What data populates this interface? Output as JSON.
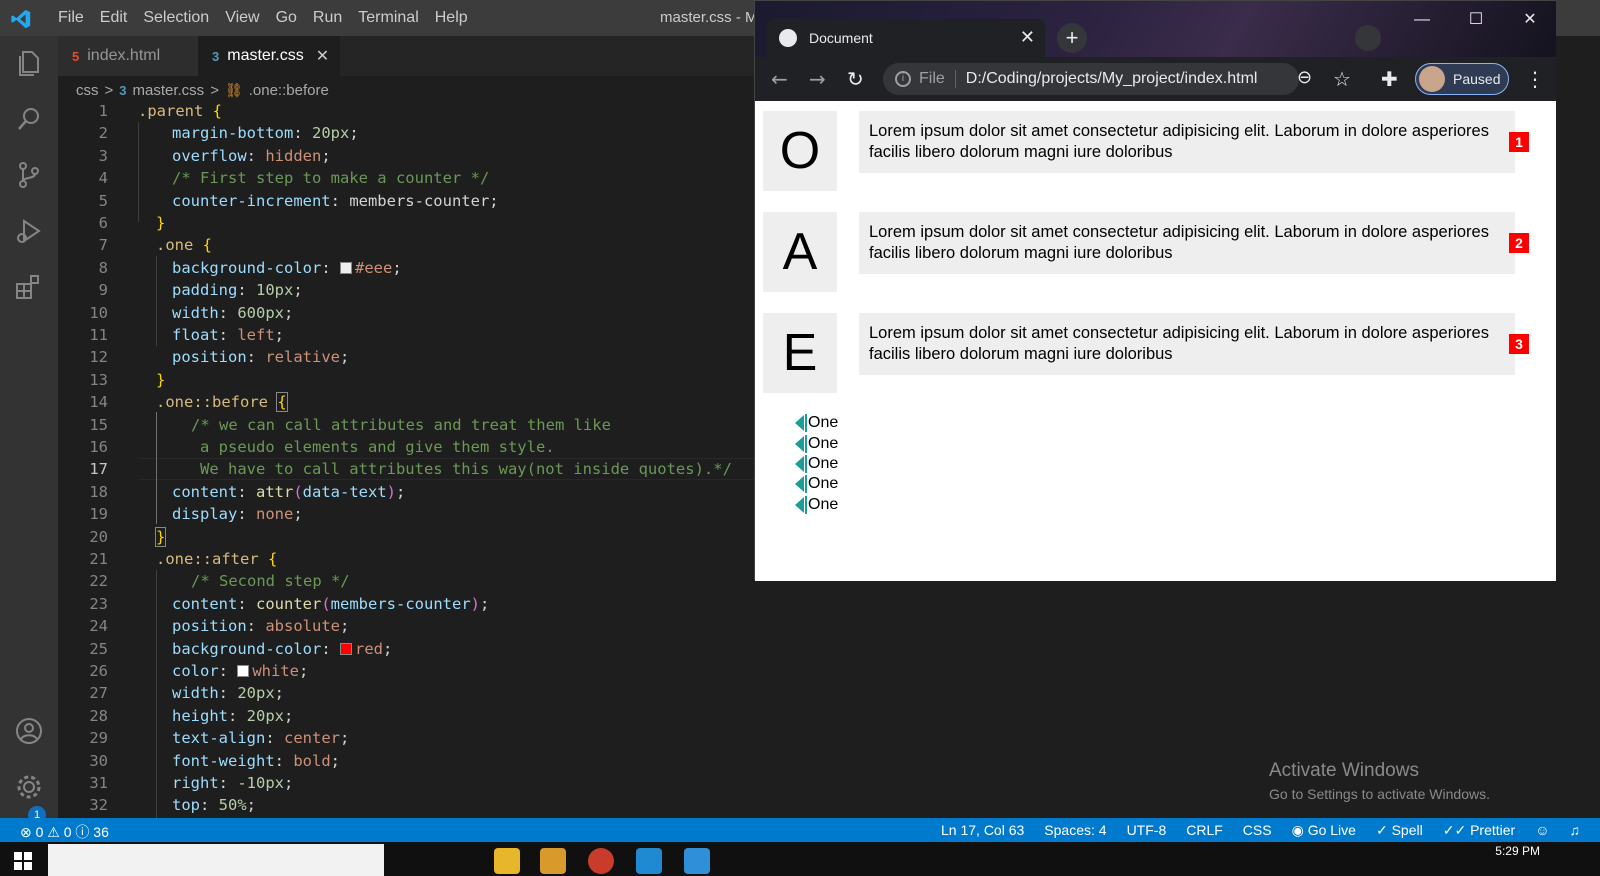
{
  "vscode": {
    "menu": [
      "File",
      "Edit",
      "Selection",
      "View",
      "Go",
      "Run",
      "Terminal",
      "Help"
    ],
    "window_title": "master.css - My_p",
    "tabs": [
      {
        "label": "index.html",
        "icon": "5"
      },
      {
        "label": "master.css",
        "icon": "3",
        "close": "✕"
      }
    ],
    "breadcrumb": {
      "folder": "css",
      "sep": ">",
      "file": "master.css",
      "symbol": ".one::before"
    },
    "settings_badge": "1",
    "line_numbers": [
      "1",
      "2",
      "3",
      "4",
      "5",
      "6",
      "7",
      "8",
      "9",
      "10",
      "11",
      "12",
      "13",
      "14",
      "15",
      "16",
      "17",
      "18",
      "19",
      "20",
      "21",
      "22",
      "23",
      "24",
      "25",
      "26",
      "27",
      "28",
      "29",
      "30",
      "31",
      "32"
    ],
    "code": {
      "l1_sel": ".parent ",
      "l1_b": "{",
      "l2_p": "margin-bottom",
      "l2_v": "20px",
      "l3_p": "overflow",
      "l3_v": "hidden",
      "l4_c": "/* First step to make a counter */",
      "l5_p": "counter-increment",
      "l5_v": "members-counter",
      "l6_b": "}",
      "l7_sel": ".one ",
      "l7_b": "{",
      "l8_p": "background-color",
      "l8_v": "#eee",
      "l9_p": "padding",
      "l9_v": "10px",
      "l10_p": "width",
      "l10_v": "600px",
      "l11_p": "float",
      "l11_v": "left",
      "l12_p": "position",
      "l12_v": "relative",
      "l13_b": "}",
      "l14_sel": ".one::before ",
      "l14_b": "{",
      "l15_c": "/* we can call attributes and treat them like",
      "l16_c": "a pseudo elements and give them style.",
      "l17_c": "We have to call attributes this way(not inside quotes).*/",
      "l18_p": "content",
      "l18_f": "attr",
      "l18_a": "data-text",
      "l19_p": "display",
      "l19_v": "none",
      "l20_b": "}",
      "l21_sel": ".one::after ",
      "l21_b": "{",
      "l22_c": "/* Second step */",
      "l23_p": "content",
      "l23_f": "counter",
      "l23_a": "members-counter",
      "l24_p": "position",
      "l24_v": "absolute",
      "l25_p": "background-color",
      "l25_v": "red",
      "l26_p": "color",
      "l26_v": "white",
      "l27_p": "width",
      "l27_v": "20px",
      "l28_p": "height",
      "l28_v": "20px",
      "l29_p": "text-align",
      "l29_v": "center",
      "l30_p": "font-weight",
      "l30_v": "bold",
      "l31_p": "right",
      "l31_v": "-10px",
      "l32_p": "top",
      "l32_v": "50%"
    },
    "status_left": "⊗ 0 ⚠ 0 ⓘ 36",
    "status_right": [
      "Ln 17, Col 63",
      "Spaces: 4",
      "UTF-8",
      "CRLF",
      "CSS",
      "Go Live",
      "Spell",
      "Prettier"
    ],
    "activate": {
      "title": "Activate Windows",
      "sub": "Go to Settings to activate Windows."
    },
    "clock": "5:29 PM"
  },
  "chrome": {
    "tab_title": "Document",
    "tab_close": "✕",
    "new_tab": "+",
    "omnibox_scheme": "File",
    "omnibox_url": "D:/Coding/projects/My_project/index.html",
    "profile_label": "Paused",
    "win_buttons": [
      "—",
      "☐",
      "✕"
    ]
  },
  "page": {
    "items": [
      {
        "letter": "O",
        "text": "Lorem ipsum dolor sit amet consectetur adipisicing elit. Laborum in dolore asperiores facilis libero dolorum magni iure doloribus",
        "count": "1"
      },
      {
        "letter": "A",
        "text": "Lorem ipsum dolor sit amet consectetur adipisicing elit. Laborum in dolore asperiores facilis libero dolorum magni iure doloribus",
        "count": "2"
      },
      {
        "letter": "E",
        "text": "Lorem ipsum dolor sit amet consectetur adipisicing elit. Laborum in dolore asperiores facilis libero dolorum magni iure doloribus",
        "count": "3"
      }
    ],
    "ones": [
      "One",
      "One",
      "One",
      "One",
      "One"
    ]
  },
  "colors": {
    "accent": "#007acc",
    "counter_bg": "#ff0000",
    "box_bg": "#eeeeee",
    "marker": "#1b9e9a"
  }
}
